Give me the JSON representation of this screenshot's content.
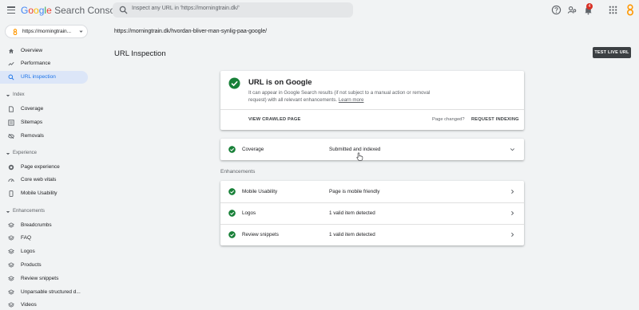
{
  "app": {
    "logo_google": [
      "G",
      "o",
      "o",
      "g",
      "l",
      "e"
    ],
    "logo_product": "Search Console",
    "search_placeholder": "Inspect any URL in 'https://morningtrain.dk/'",
    "notification_count": "4",
    "icons": [
      "menu-icon",
      "search-icon",
      "help-icon",
      "people-icon",
      "bell-icon",
      "apps-icon",
      "account-icon"
    ]
  },
  "sidebar": {
    "property": "https://morningtrain...",
    "top_items": [
      {
        "label": "Overview",
        "icon": "home-icon"
      },
      {
        "label": "Performance",
        "icon": "trending-icon"
      },
      {
        "label": "URL inspection",
        "icon": "search-icon",
        "active": true
      }
    ],
    "sections": [
      {
        "label": "Index",
        "items": [
          {
            "label": "Coverage",
            "icon": "file-icon"
          },
          {
            "label": "Sitemaps",
            "icon": "sitemap-icon"
          },
          {
            "label": "Removals",
            "icon": "eye-off-icon"
          }
        ]
      },
      {
        "label": "Experience",
        "items": [
          {
            "label": "Page experience",
            "icon": "target-icon"
          },
          {
            "label": "Core web vitals",
            "icon": "gauge-icon"
          },
          {
            "label": "Mobile Usability",
            "icon": "phone-icon"
          }
        ]
      },
      {
        "label": "Enhancements",
        "items": [
          {
            "label": "Breadcrumbs",
            "icon": "layers-icon"
          },
          {
            "label": "FAQ",
            "icon": "layers-icon"
          },
          {
            "label": "Logos",
            "icon": "layers-icon"
          },
          {
            "label": "Products",
            "icon": "layers-icon"
          },
          {
            "label": "Review snippets",
            "icon": "layers-icon"
          },
          {
            "label": "Unparsable structured d...",
            "icon": "layers-icon"
          },
          {
            "label": "Videos",
            "icon": "layers-icon"
          }
        ]
      }
    ]
  },
  "main": {
    "url": "https://morningtrain.dk/hvordan-bliver-man-synlig-paa-google/",
    "title": "URL Inspection",
    "test_live_label": "TEST LIVE URL",
    "status": {
      "title": "URL is on Google",
      "description": "It can appear in Google Search results (if not subject to a manual action or removal request) with all relevant enhancements.",
      "learn_more": "Learn more",
      "view_crawled": "VIEW CRAWLED PAGE",
      "page_changed": "Page changed?",
      "request_indexing": "REQUEST INDEXING"
    },
    "coverage": {
      "label": "Coverage",
      "value": "Submitted and indexed"
    },
    "enhancements_label": "Enhancements",
    "enhancements": [
      {
        "label": "Mobile Usability",
        "value": "Page is mobile friendly"
      },
      {
        "label": "Logos",
        "value": "1 valid item detected"
      },
      {
        "label": "Review snippets",
        "value": "1 valid item detected"
      }
    ]
  },
  "colors": {
    "accent": "#1a73e8",
    "success": "#188038",
    "active_bg": "#dce6f8",
    "button_dark": "#3c4043"
  }
}
